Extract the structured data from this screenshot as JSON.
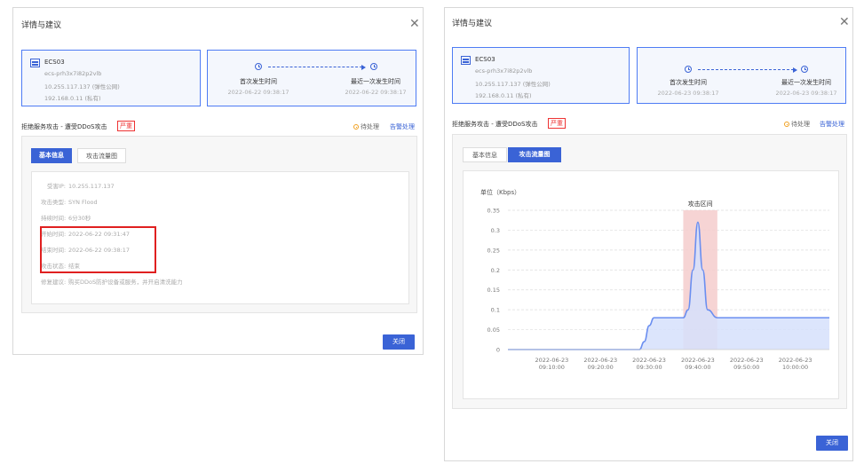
{
  "dialog_title": "详情与建议",
  "left": {
    "close_label": "关闭",
    "first_time": "2022-06-22 09:38:17",
    "last_time": "2022-06-22 09:38:17",
    "tabs": [
      "基本信息",
      "攻击流量图"
    ],
    "active_tab": 0
  },
  "right": {
    "close_label": "关闭",
    "first_time": "2022-06-23 09:38:17",
    "last_time": "2022-06-23 09:38:17",
    "tabs": [
      "基本信息",
      "攻击流量图"
    ],
    "active_tab": 1
  },
  "resource": {
    "name": "ECS03",
    "id": "ecs-prh3x7i82p2vlb",
    "public_ip": "10.255.117.137 (弹性公网)",
    "private_ip": "192.168.0.11 (私有)"
  },
  "timeline": {
    "first_label": "首次发生时间",
    "last_label": "最近一次发生时间"
  },
  "event": {
    "title": "拒绝服务攻击 - 遭受DDoS攻击",
    "severity": "严重",
    "status": "待处理",
    "action": "告警处理"
  },
  "details": [
    {
      "key": "受害IP:",
      "value": "10.255.117.137"
    },
    {
      "key": "攻击类型:",
      "value": "SYN Flood"
    },
    {
      "key": "持续时间:",
      "value": "6分30秒"
    },
    {
      "key": "开始时间:",
      "value": "2022-06-22 09:31:47"
    },
    {
      "key": "结束时间:",
      "value": "2022-06-22 09:38:17"
    },
    {
      "key": "攻击状态:",
      "value": "结束"
    },
    {
      "key": "修复建议:",
      "value": "购买DDoS防护设备或服务，并开启清洗能力"
    }
  ],
  "colors": {
    "accent": "#3a63d6",
    "severity": "#e33333",
    "highlight": "#e02020",
    "attack_zone": "#f4cccc",
    "area_fill": "#d6e1fb"
  },
  "chart_data": {
    "type": "area",
    "unit_label": "单位（Kbps）",
    "annotation": "攻击区间",
    "annotation_range": [
      "2022-06-23 09:37:00",
      "2022-06-23 09:44:00"
    ],
    "yticks": [
      "0",
      "0.05",
      "0.1",
      "0.15",
      "0.2",
      "0.25",
      "0.3",
      "0.35"
    ],
    "ylim": [
      0,
      0.35
    ],
    "xlim": [
      "2022-06-23 09:01:00",
      "2022-06-23 10:07:00"
    ],
    "xticks": [
      {
        "date": "2022-06-23",
        "time": "09:10:00"
      },
      {
        "date": "2022-06-23",
        "time": "09:20:00"
      },
      {
        "date": "2022-06-23",
        "time": "09:30:00"
      },
      {
        "date": "2022-06-23",
        "time": "09:40:00"
      },
      {
        "date": "2022-06-23",
        "time": "09:50:00"
      },
      {
        "date": "2022-06-23",
        "time": "10:00:00"
      }
    ],
    "x": [
      "2022-06-23 09:01:00",
      "2022-06-23 09:28:00",
      "2022-06-23 09:29:00",
      "2022-06-23 09:30:00",
      "2022-06-23 09:31:00",
      "2022-06-23 09:37:00",
      "2022-06-23 09:38:00",
      "2022-06-23 09:39:00",
      "2022-06-23 09:40:00",
      "2022-06-23 09:41:00",
      "2022-06-23 09:42:00",
      "2022-06-23 09:44:00",
      "2022-06-23 10:07:00"
    ],
    "y": [
      0,
      0,
      0.02,
      0.06,
      0.08,
      0.08,
      0.1,
      0.2,
      0.32,
      0.2,
      0.1,
      0.08,
      0.08
    ]
  }
}
